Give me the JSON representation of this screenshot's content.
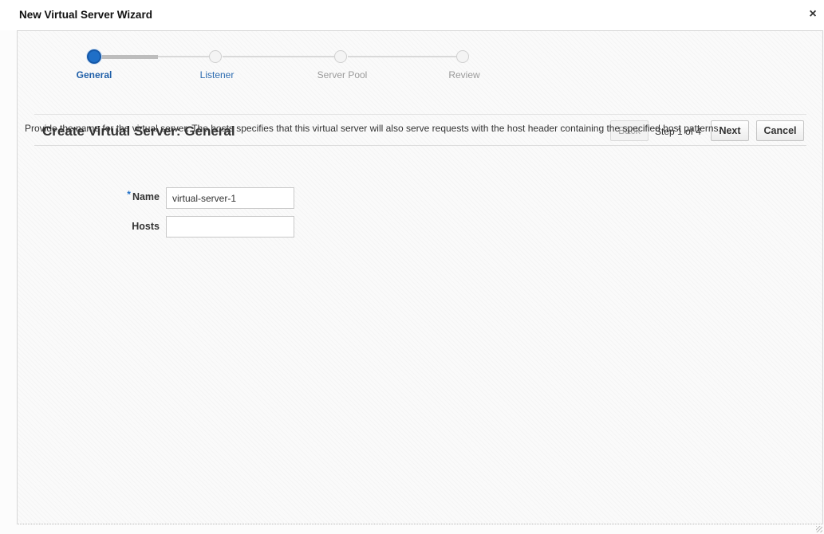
{
  "dialog": {
    "title": "New Virtual Server Wizard",
    "close_symbol": "×"
  },
  "train": {
    "steps": [
      {
        "label": "General",
        "state": "current"
      },
      {
        "label": "Listener",
        "state": "enabled"
      },
      {
        "label": "Server Pool",
        "state": "disabled"
      },
      {
        "label": "Review",
        "state": "disabled"
      }
    ]
  },
  "header": {
    "title": "Create Virtual Server: General",
    "back_label": "Back",
    "step_text": "Step 1 of 4",
    "next_label": "Next",
    "cancel_label": "Cancel"
  },
  "description": "Provide the name for the virtual server. The hosts specifies that this virtual server will also serve requests with the host header containing the specified host patterns.",
  "form": {
    "required_marker": "*",
    "name_label": "Name",
    "name_value": "virtual-server-1",
    "hosts_label": "Hosts",
    "hosts_value": ""
  },
  "colors": {
    "accent": "#1f6fc7",
    "link": "#2c6bb0",
    "disabled_text": "#9a9a9a"
  }
}
